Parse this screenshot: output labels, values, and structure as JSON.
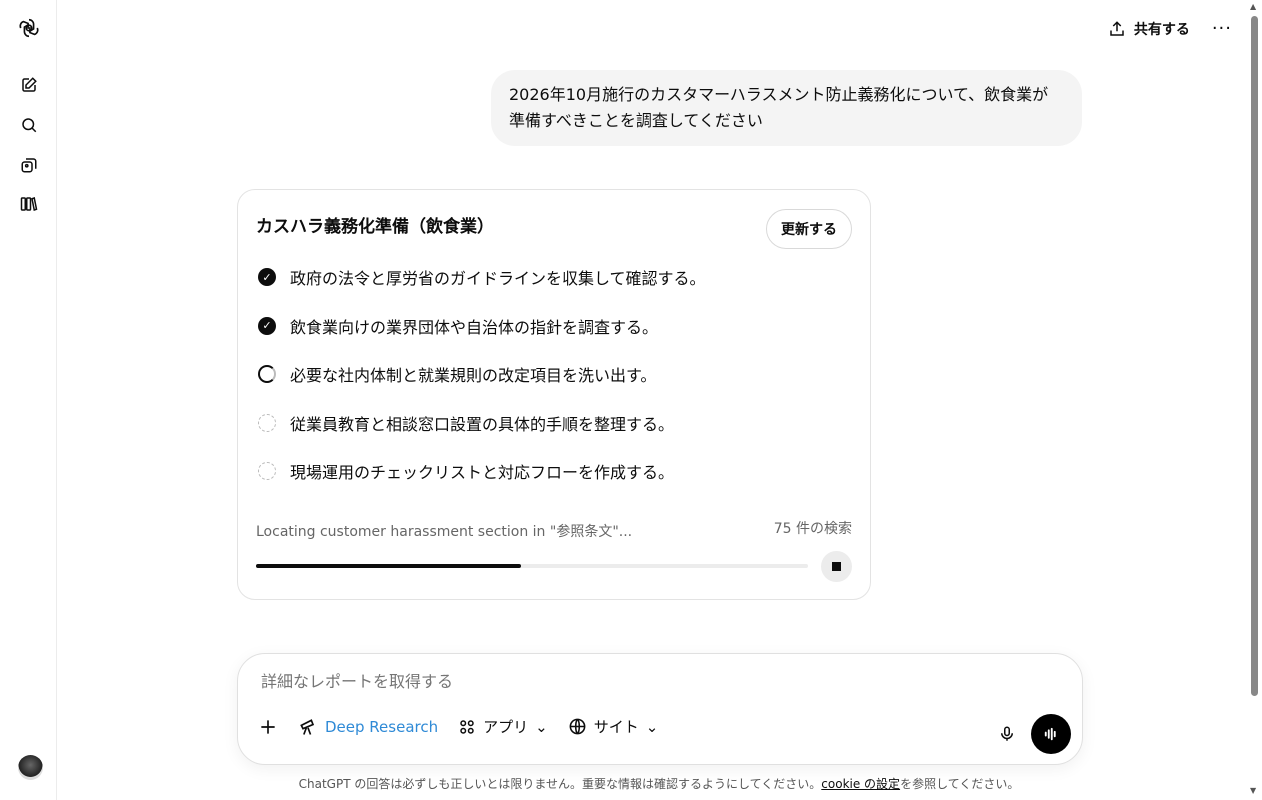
{
  "header": {
    "share_label": "共有する",
    "more_label": "···"
  },
  "user_message": "2026年10月施行のカスタマーハラスメント防止義務化について、飲食業が準備すべきことを調査してください",
  "research": {
    "title": "カスハラ義務化準備（飲食業）",
    "update_label": "更新する",
    "steps": [
      {
        "text": "政府の法令と厚労省のガイドラインを収集して確認する。",
        "state": "done"
      },
      {
        "text": "飲食業向けの業界団体や自治体の指針を調査する。",
        "state": "done"
      },
      {
        "text": "必要な社内体制と就業規則の改定項目を洗い出す。",
        "state": "active"
      },
      {
        "text": "従業員教育と相談窓口設置の具体的手順を整理する。",
        "state": "pending"
      },
      {
        "text": "現場運用のチェックリストと対応フローを作成する。",
        "state": "pending"
      }
    ],
    "status": "Locating customer harassment section in \"参照条文\"...",
    "search_count": "75 件の検索",
    "progress": 0.48
  },
  "composer": {
    "placeholder": "詳細なレポートを取得する",
    "deep_research": "Deep Research",
    "apps": "アプリ",
    "sites": "サイト"
  },
  "footer": {
    "text": "ChatGPT の回答は必ずしも正しいとは限りません。重要な情報は確認するようにしてください。",
    "link": "cookie の設定",
    "suffix": "を参照してください。"
  },
  "colors": {
    "accent": "#2f8ad6"
  }
}
